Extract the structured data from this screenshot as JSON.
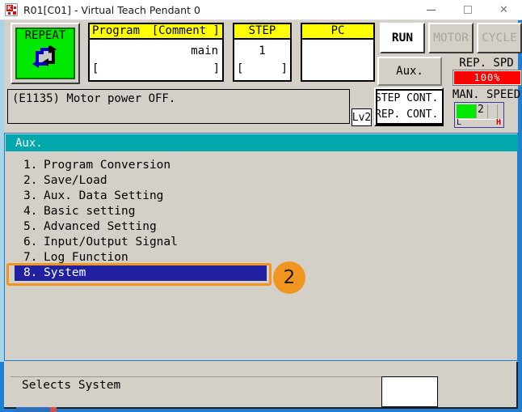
{
  "window": {
    "title": "R01[C01] - Virtual Teach Pendant 0",
    "icon": "app-icon",
    "minimize": "minimize-icon",
    "maximize": "maximize-icon",
    "close": "✕"
  },
  "header": {
    "mode_button": {
      "label": "REPEAT",
      "icon": "cycle-arrows-icon",
      "color": "#00e800"
    },
    "program_box": {
      "head_left": "Program",
      "head_right": "[Comment ]",
      "value": "main",
      "bracket_left": "[",
      "bracket_right": "]"
    },
    "step_box": {
      "head": "STEP",
      "value": "1",
      "bracket_left": "[",
      "bracket_right": "]"
    },
    "pc_box": {
      "head": "PC",
      "value": "",
      "bracket_left": "",
      "bracket_right": ""
    },
    "status_buttons": [
      {
        "label": "RUN",
        "state": "on"
      },
      {
        "label": "MOTOR",
        "state": "off"
      },
      {
        "label": "CYCLE",
        "state": "off"
      }
    ],
    "aux_side_button": "Aux.",
    "rep_speed": {
      "label": "REP. SPD",
      "value": "100%",
      "color": "#ff0000"
    },
    "man_speed": {
      "label": "MAN. SPEED",
      "value": "2",
      "low_mark": "L",
      "high_mark": "H",
      "fill_color": "#00e800"
    },
    "message": {
      "text": "(E1135) Motor power OFF.",
      "level_badge": "Lv2"
    },
    "continue_box": {
      "line1": "STEP CONT.",
      "line2": "REP. CONT."
    }
  },
  "content": {
    "tab_label": "Aux.",
    "menu_items": [
      {
        "num": "1.",
        "label": "Program Conversion"
      },
      {
        "num": "2.",
        "label": "Save/Load"
      },
      {
        "num": "3.",
        "label": "Aux. Data Setting"
      },
      {
        "num": "4.",
        "label": "Basic setting"
      },
      {
        "num": "5.",
        "label": "Advanced Setting"
      },
      {
        "num": "6.",
        "label": "Input/Output Signal"
      },
      {
        "num": "7.",
        "label": "Log Function"
      },
      {
        "num": "8.",
        "label": "System"
      }
    ],
    "selected_index": 7
  },
  "annotation": {
    "badge_number": "2",
    "color": "#f0951e"
  },
  "bottom": {
    "hint_text": "Selects System",
    "input_value": ""
  }
}
